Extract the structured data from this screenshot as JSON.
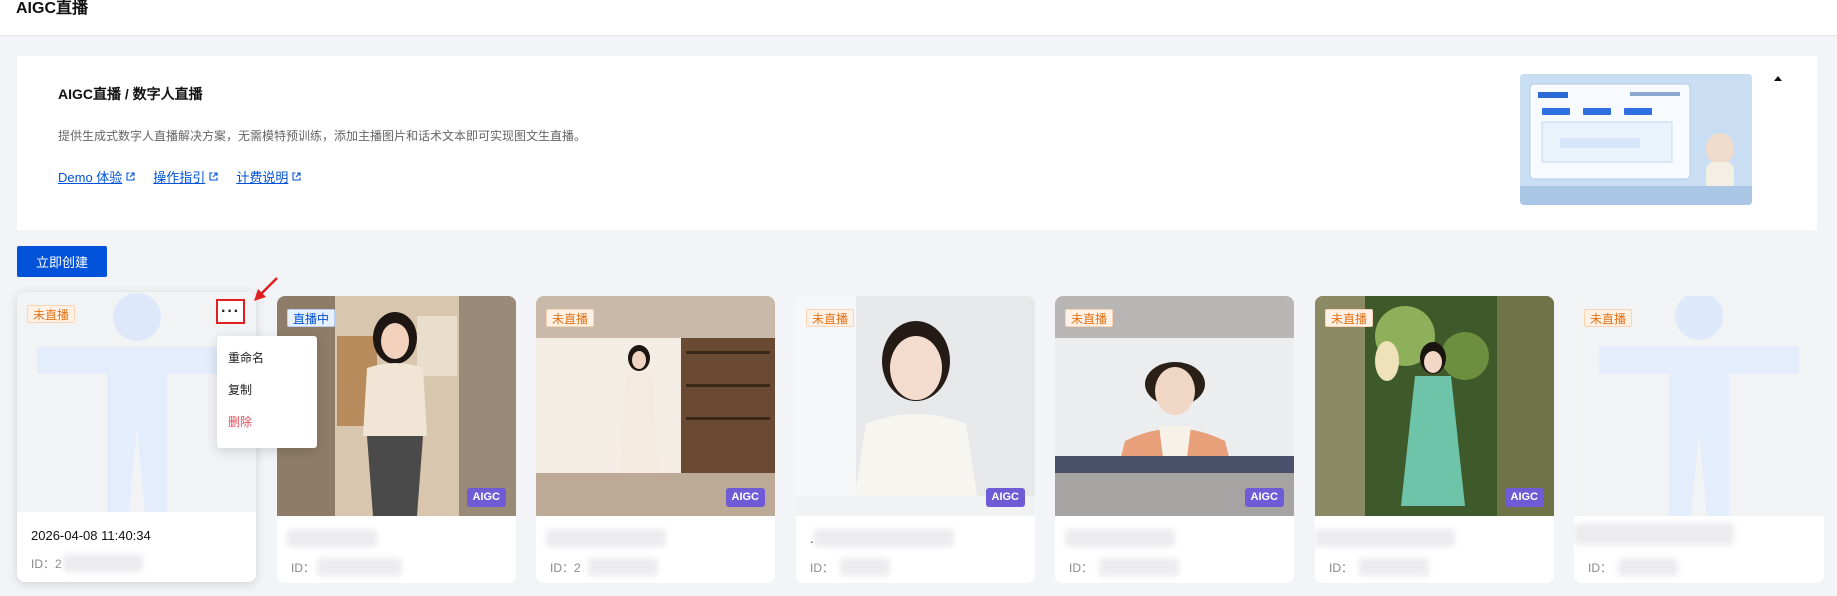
{
  "header": {
    "title": "AIGC直播"
  },
  "intro": {
    "title": "AIGC直播 / 数字人直播",
    "description": "提供生成式数字人直播解决方案，无需模特预训练，添加主播图片和话术文本即可实现图文生直播。",
    "links": [
      {
        "label": "Demo 体验",
        "icon": "external-link-icon"
      },
      {
        "label": "操作指引",
        "icon": "external-link-icon"
      },
      {
        "label": "计费说明",
        "icon": "external-link-icon"
      }
    ],
    "collapse_icon": "caret-up-icon"
  },
  "create_button": {
    "label": "立即创建"
  },
  "menu": {
    "items": [
      {
        "label": "重命名"
      },
      {
        "label": "复制"
      },
      {
        "label": "删除"
      }
    ]
  },
  "cards": [
    {
      "status": "未直播",
      "badge": "",
      "name": "2026-04-08 11:40:34",
      "id_label": "ID：",
      "id_value": "2",
      "placeholder": "person-silhouette"
    },
    {
      "status": "直播中",
      "badge": "AIGC",
      "name": "",
      "id_label": "ID：",
      "id_value": "",
      "scene": "kitchen"
    },
    {
      "status": "未直播",
      "badge": "AIGC",
      "name": "",
      "id_label": "ID：",
      "id_value": "2",
      "scene": "bookshelf"
    },
    {
      "status": "未直播",
      "badge": "AIGC",
      "name": ".",
      "id_label": "ID：",
      "id_value": "",
      "scene": "office"
    },
    {
      "status": "未直播",
      "badge": "AIGC",
      "name": "",
      "id_label": "ID：",
      "id_value": "",
      "scene": "studio"
    },
    {
      "status": "未直播",
      "badge": "AIGC",
      "name": "",
      "id_label": "ID：",
      "id_value": "",
      "scene": "forest"
    },
    {
      "status": "未直播",
      "badge": "",
      "name": "",
      "id_label": "ID：",
      "id_value": "",
      "placeholder": "person-silhouette"
    }
  ],
  "colors": {
    "primary": "#0052d9",
    "offline_status": "#e37318",
    "online_status": "#0052d9",
    "aigc_badge": "#6f5bd6",
    "danger": "#e34d59",
    "highlight": "#e02020"
  }
}
